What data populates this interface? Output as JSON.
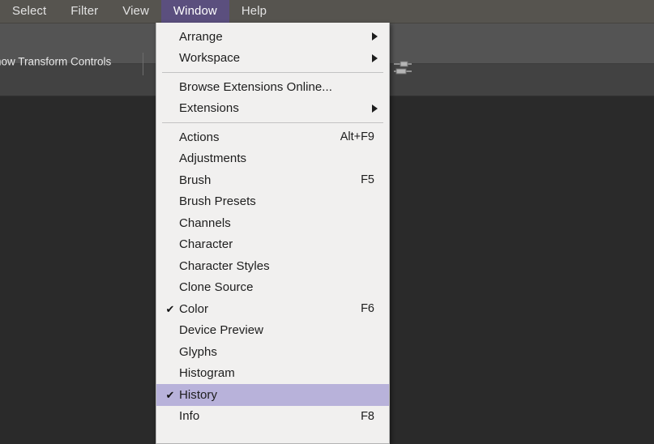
{
  "app": {
    "accent_highlight": "#5b4f7e",
    "menu_highlight": "#b8b2da",
    "menubar_bg": "#56544f",
    "options_bg": "#545454",
    "canvas_bg": "#2a2a2a",
    "menu_bg": "#f1f0ef"
  },
  "menubar": {
    "items": [
      {
        "label": "Select",
        "active": false
      },
      {
        "label": "Filter",
        "active": false
      },
      {
        "label": "View",
        "active": false
      },
      {
        "label": "Window",
        "active": true
      },
      {
        "label": "Help",
        "active": false
      }
    ]
  },
  "options_bar": {
    "transform_controls_label": "how Transform Controls",
    "sliders_icon": "sliders-icon"
  },
  "window_menu": {
    "title": "Window",
    "groups": [
      {
        "items": [
          {
            "label": "Arrange",
            "shortcut": "",
            "checked": false,
            "submenu": true,
            "highlighted": false
          },
          {
            "label": "Workspace",
            "shortcut": "",
            "checked": false,
            "submenu": true,
            "highlighted": false
          }
        ]
      },
      {
        "items": [
          {
            "label": "Browse Extensions Online...",
            "shortcut": "",
            "checked": false,
            "submenu": false,
            "highlighted": false
          },
          {
            "label": "Extensions",
            "shortcut": "",
            "checked": false,
            "submenu": true,
            "highlighted": false
          }
        ]
      },
      {
        "items": [
          {
            "label": "Actions",
            "shortcut": "Alt+F9",
            "checked": false,
            "submenu": false,
            "highlighted": false
          },
          {
            "label": "Adjustments",
            "shortcut": "",
            "checked": false,
            "submenu": false,
            "highlighted": false
          },
          {
            "label": "Brush",
            "shortcut": "F5",
            "checked": false,
            "submenu": false,
            "highlighted": false
          },
          {
            "label": "Brush Presets",
            "shortcut": "",
            "checked": false,
            "submenu": false,
            "highlighted": false
          },
          {
            "label": "Channels",
            "shortcut": "",
            "checked": false,
            "submenu": false,
            "highlighted": false
          },
          {
            "label": "Character",
            "shortcut": "",
            "checked": false,
            "submenu": false,
            "highlighted": false
          },
          {
            "label": "Character Styles",
            "shortcut": "",
            "checked": false,
            "submenu": false,
            "highlighted": false
          },
          {
            "label": "Clone Source",
            "shortcut": "",
            "checked": false,
            "submenu": false,
            "highlighted": false
          },
          {
            "label": "Color",
            "shortcut": "F6",
            "checked": true,
            "submenu": false,
            "highlighted": false
          },
          {
            "label": "Device Preview",
            "shortcut": "",
            "checked": false,
            "submenu": false,
            "highlighted": false
          },
          {
            "label": "Glyphs",
            "shortcut": "",
            "checked": false,
            "submenu": false,
            "highlighted": false
          },
          {
            "label": "Histogram",
            "shortcut": "",
            "checked": false,
            "submenu": false,
            "highlighted": false
          },
          {
            "label": "History",
            "shortcut": "",
            "checked": true,
            "submenu": false,
            "highlighted": true
          },
          {
            "label": "Info",
            "shortcut": "F8",
            "checked": false,
            "submenu": false,
            "highlighted": false
          }
        ]
      }
    ],
    "check_glyph": "✔"
  }
}
